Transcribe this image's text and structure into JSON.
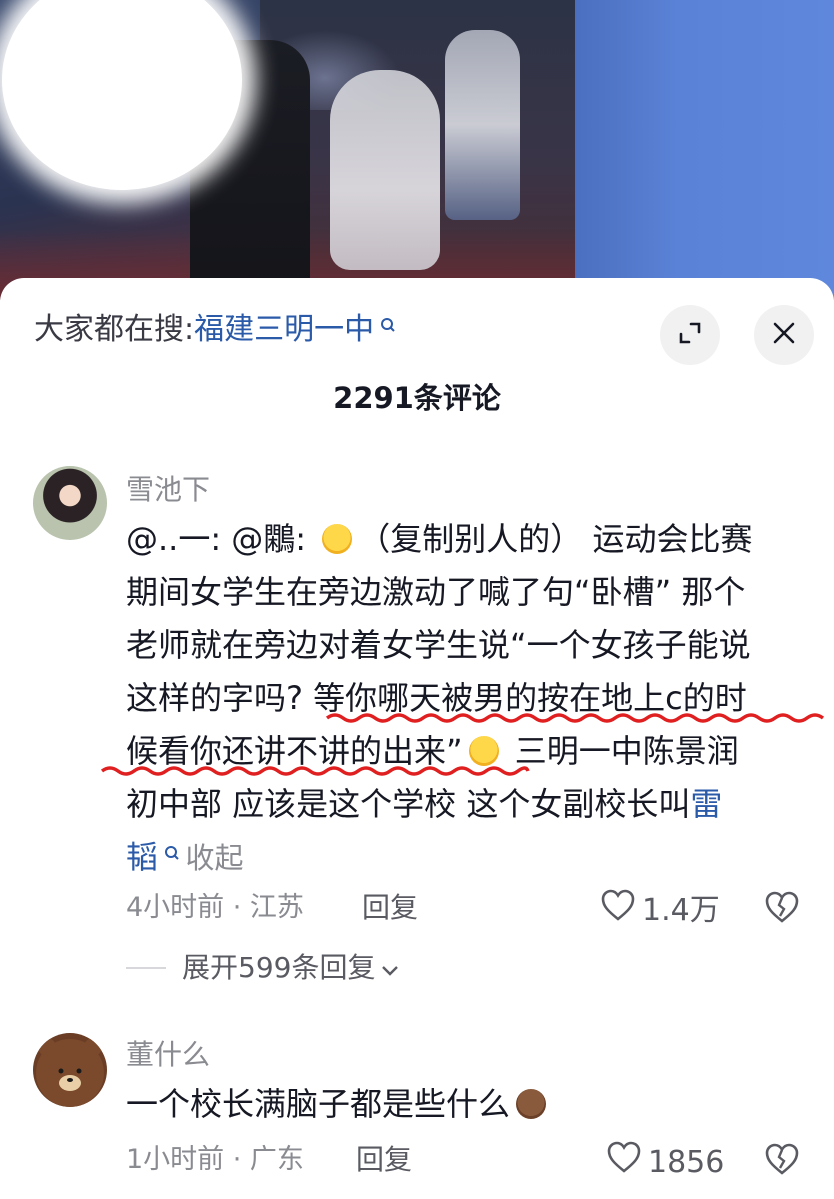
{
  "search_bar": {
    "prefix": "大家都在搜:",
    "keyword": "福建三明一中"
  },
  "header": {
    "comment_count": "2291条评论"
  },
  "comments": [
    {
      "username": "雪池下",
      "text_lines": [
        "@..一: @鷴: ",
        "（复制别人的） 运动会比赛",
        "期间女学生在旁边激动了喊了句“卧槽” 那个",
        "老师就在旁边对着女学生说“一个女孩子能说",
        "这样的字吗? ",
        "等你哪天被男的按在地上c的时",
        "候看你还讲不讲的出来”",
        " 三明一中陈景润",
        "初中部 应该是这个学校 这个女副校长叫",
        "雷",
        "韬",
        "收起"
      ],
      "time_location": "4小时前 · 江苏",
      "reply_label": "回复",
      "likes": "1.4万",
      "expand_replies": "展开599条回复"
    },
    {
      "username": "董什么",
      "text": "一个校长满脑子都是些什么",
      "time_location": "1小时前 · 广东",
      "reply_label": "回复",
      "likes": "1856"
    }
  ],
  "colors": {
    "link_blue": "#2a5aa8",
    "underline_red": "#e02020",
    "meta_grey": "#8a8b91"
  }
}
